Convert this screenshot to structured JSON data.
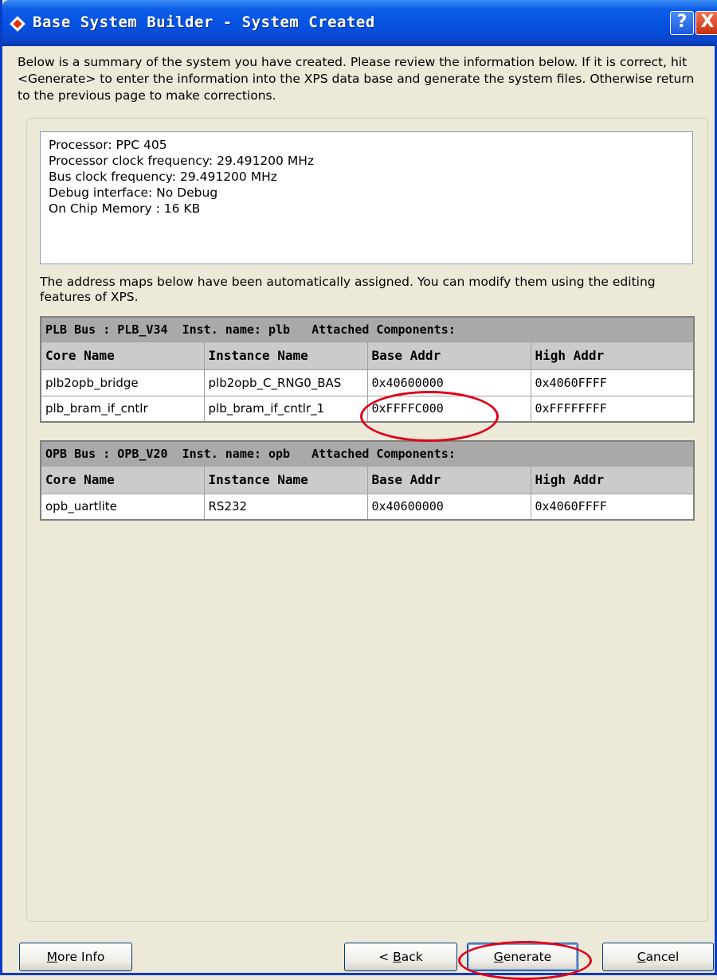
{
  "window": {
    "title": "Base System Builder - System Created",
    "help_label": "?",
    "close_label": "X"
  },
  "intro_text": "Below is a summary of the system you have created. Please review the information below. If it is correct, hit <Generate> to enter the information into the XPS data base and generate the system files. Otherwise return to the previous page to make corrections.",
  "summary_lines": [
    "Processor: PPC 405",
    "Processor clock frequency: 29.491200 MHz",
    "Bus clock frequency: 29.491200 MHz",
    "Debug interface: No Debug",
    "On Chip Memory :  16 KB"
  ],
  "address_note": "The address maps below have been automatically assigned.  You can modify them using the editing features of XPS.",
  "plb_table": {
    "title": "PLB Bus : PLB_V34  Inst. name: plb   Attached Components:",
    "headers": [
      "Core Name",
      "Instance Name",
      "Base Addr",
      "High Addr"
    ],
    "rows": [
      [
        "plb2opb_bridge",
        "plb2opb_C_RNG0_BAS",
        "0x40600000",
        "0x4060FFFF"
      ],
      [
        "plb_bram_if_cntlr",
        "plb_bram_if_cntlr_1",
        "0xFFFFC000",
        "0xFFFFFFFF"
      ]
    ]
  },
  "opb_table": {
    "title": "OPB Bus : OPB_V20  Inst. name: opb   Attached Components:",
    "headers": [
      "Core Name",
      "Instance Name",
      "Base Addr",
      "High Addr"
    ],
    "rows": [
      [
        "opb_uartlite",
        "RS232",
        "0x40600000",
        "0x4060FFFF"
      ]
    ]
  },
  "buttons": {
    "more_info": {
      "mnemonic": "M",
      "rest": "ore Info"
    },
    "back": {
      "prefix": "< ",
      "mnemonic": "B",
      "rest": "ack"
    },
    "generate": {
      "mnemonic": "G",
      "rest": "enerate"
    },
    "cancel": {
      "mnemonic": "C",
      "rest": "ancel"
    }
  },
  "colors": {
    "titlebar": "#0550e0",
    "dialog_bg": "#ece9d8",
    "annotation_ring": "#e0001a"
  }
}
